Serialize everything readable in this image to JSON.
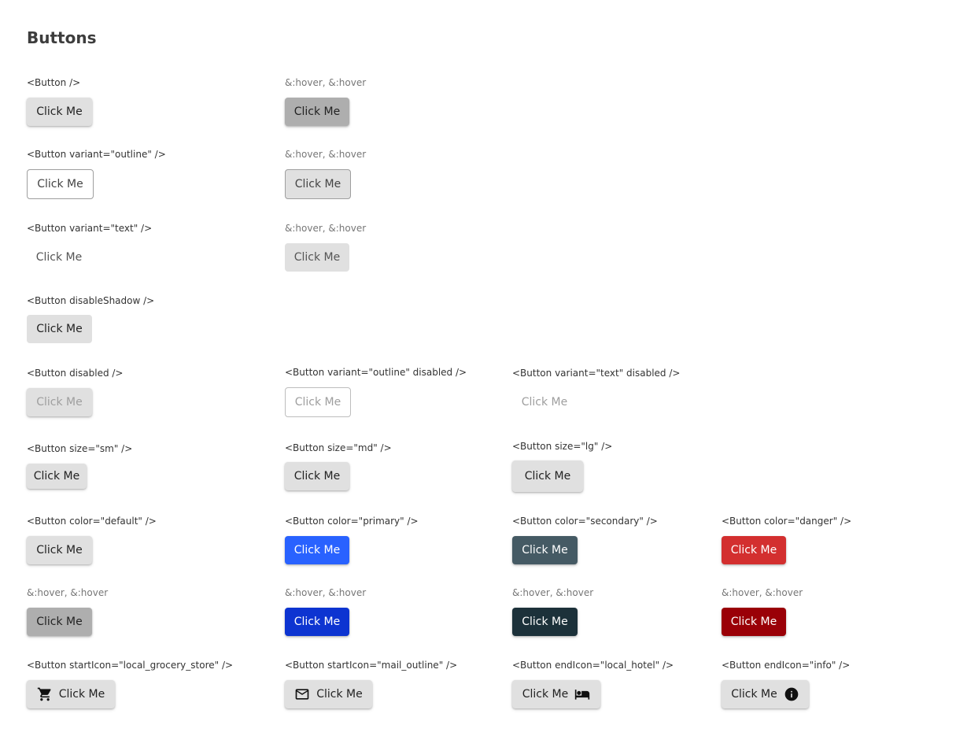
{
  "page": {
    "title": "Buttons"
  },
  "captions": {
    "default": "<Button />",
    "outline": "<Button variant=\"outline\" />",
    "text": "<Button variant=\"text\" />",
    "disable_shadow": "<Button disableShadow />",
    "disabled": "<Button disabled />",
    "outline_disabled": "<Button variant=\"outline\" disabled />",
    "text_disabled": "<Button variant=\"text\" disabled />",
    "size_sm": "<Button size=\"sm\" />",
    "size_md": "<Button size=\"md\" />",
    "size_lg": "<Button size=\"lg\" />",
    "color_default": "<Button color=\"default\" />",
    "color_primary": "<Button color=\"primary\" />",
    "color_secondary": "<Button color=\"secondary\" />",
    "color_danger": "<Button color=\"danger\" />",
    "hover": "&:hover, &:hover",
    "start_icon_grocery": "<Button startIcon=\"local_grocery_store\" />",
    "start_icon_mail": "<Button startIcon=\"mail_outline\" />",
    "end_icon_hotel": "<Button endIcon=\"local_hotel\" />",
    "end_icon_info": "<Button endIcon=\"info\" />"
  },
  "button_label": "Click Me",
  "icons": {
    "grocery": "cart-icon",
    "mail": "mail-icon",
    "hotel": "hotel-bed-icon",
    "info": "info-icon"
  },
  "colors": {
    "default": "#e0e0e0",
    "default_hover": "#aeaeae",
    "primary": "#2962ff",
    "primary_hover": "#0d34d1",
    "secondary": "#455a64",
    "secondary_hover": "#1c313a",
    "danger": "#d32f2f",
    "danger_hover": "#9a0007",
    "disabled_text": "#9e9e9e"
  }
}
